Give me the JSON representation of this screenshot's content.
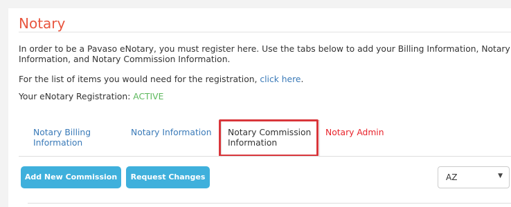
{
  "page": {
    "title": "Notary",
    "intro": "In order to be a Pavaso eNotary, you must register here. Use the tabs below to add your Billing Information, Notary Information, and Notary Commission Information.",
    "intro_line1": "In order to be a Pavaso eNotary, you must register here. Use the tabs below to add your Billing Information, Notary",
    "intro_line2": "Information, and Notary Commission Information.",
    "items_prefix": "For the list of items you would need for the registration,",
    "items_link": "click here",
    "items_suffix": ".",
    "registration_label": "Your eNotary Registration:",
    "registration_status": "ACTIVE"
  },
  "tabs": [
    {
      "line1": "Notary Billing",
      "line2": "Information"
    },
    {
      "label": "Notary Information"
    },
    {
      "line1": "Notary Commission",
      "line2": "Information"
    },
    {
      "label": "Notary Admin"
    }
  ],
  "actions": {
    "add_label": "Add New Commission",
    "request_label": "Request Changes"
  },
  "state_select": {
    "value": "AZ"
  },
  "colors": {
    "title": "#e8563f",
    "link": "#3a7ab8",
    "active_status": "#5cb85c",
    "admin_tab": "#e8232b",
    "button": "#3fb0dc",
    "highlight": "#d9363b"
  },
  "icons": {
    "select_arrow": "chevron-down-icon"
  }
}
